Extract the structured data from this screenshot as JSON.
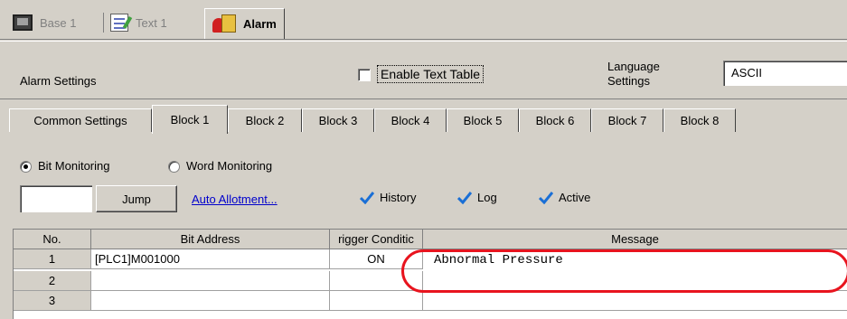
{
  "doc_tabs": [
    {
      "label": "Base 1",
      "icon": "monitor-icon",
      "active": false
    },
    {
      "label": "Text 1",
      "icon": "text-edit-icon",
      "active": false
    },
    {
      "label": "Alarm",
      "icon": "alarm-icon",
      "active": true
    }
  ],
  "settings": {
    "title": "Alarm Settings",
    "enable_text_table": {
      "label": "Enable Text Table",
      "checked": false
    },
    "language_label": "Language Settings",
    "language_value": "ASCII"
  },
  "block_tabs": [
    {
      "label": "Common Settings",
      "active": false
    },
    {
      "label": "Block 1",
      "active": true
    },
    {
      "label": "Block 2",
      "active": false
    },
    {
      "label": "Block 3",
      "active": false
    },
    {
      "label": "Block 4",
      "active": false
    },
    {
      "label": "Block 5",
      "active": false
    },
    {
      "label": "Block 6",
      "active": false
    },
    {
      "label": "Block 7",
      "active": false
    },
    {
      "label": "Block 8",
      "active": false
    }
  ],
  "monitoring": {
    "bit_label": "Bit Monitoring",
    "word_label": "Word Monitoring",
    "selected": "bit"
  },
  "toolbar": {
    "jump_value": "",
    "jump_label": "Jump",
    "auto_allotment_label": "Auto Allotment...",
    "checks": [
      {
        "label": "History",
        "checked": true
      },
      {
        "label": "Log",
        "checked": true
      },
      {
        "label": "Active",
        "checked": true
      }
    ]
  },
  "grid": {
    "columns": [
      "No.",
      "Bit Address",
      "rigger Conditic",
      "Message"
    ],
    "rows": [
      {
        "no": "1",
        "address": "[PLC1]M001000",
        "trigger": "ON",
        "message": "Abnormal Pressure"
      },
      {
        "no": "2",
        "address": "",
        "trigger": "",
        "message": ""
      },
      {
        "no": "3",
        "address": "",
        "trigger": "",
        "message": ""
      }
    ]
  },
  "colors": {
    "highlight": "#e8141e",
    "check": "#1a6fd6",
    "link": "#0000cc"
  }
}
